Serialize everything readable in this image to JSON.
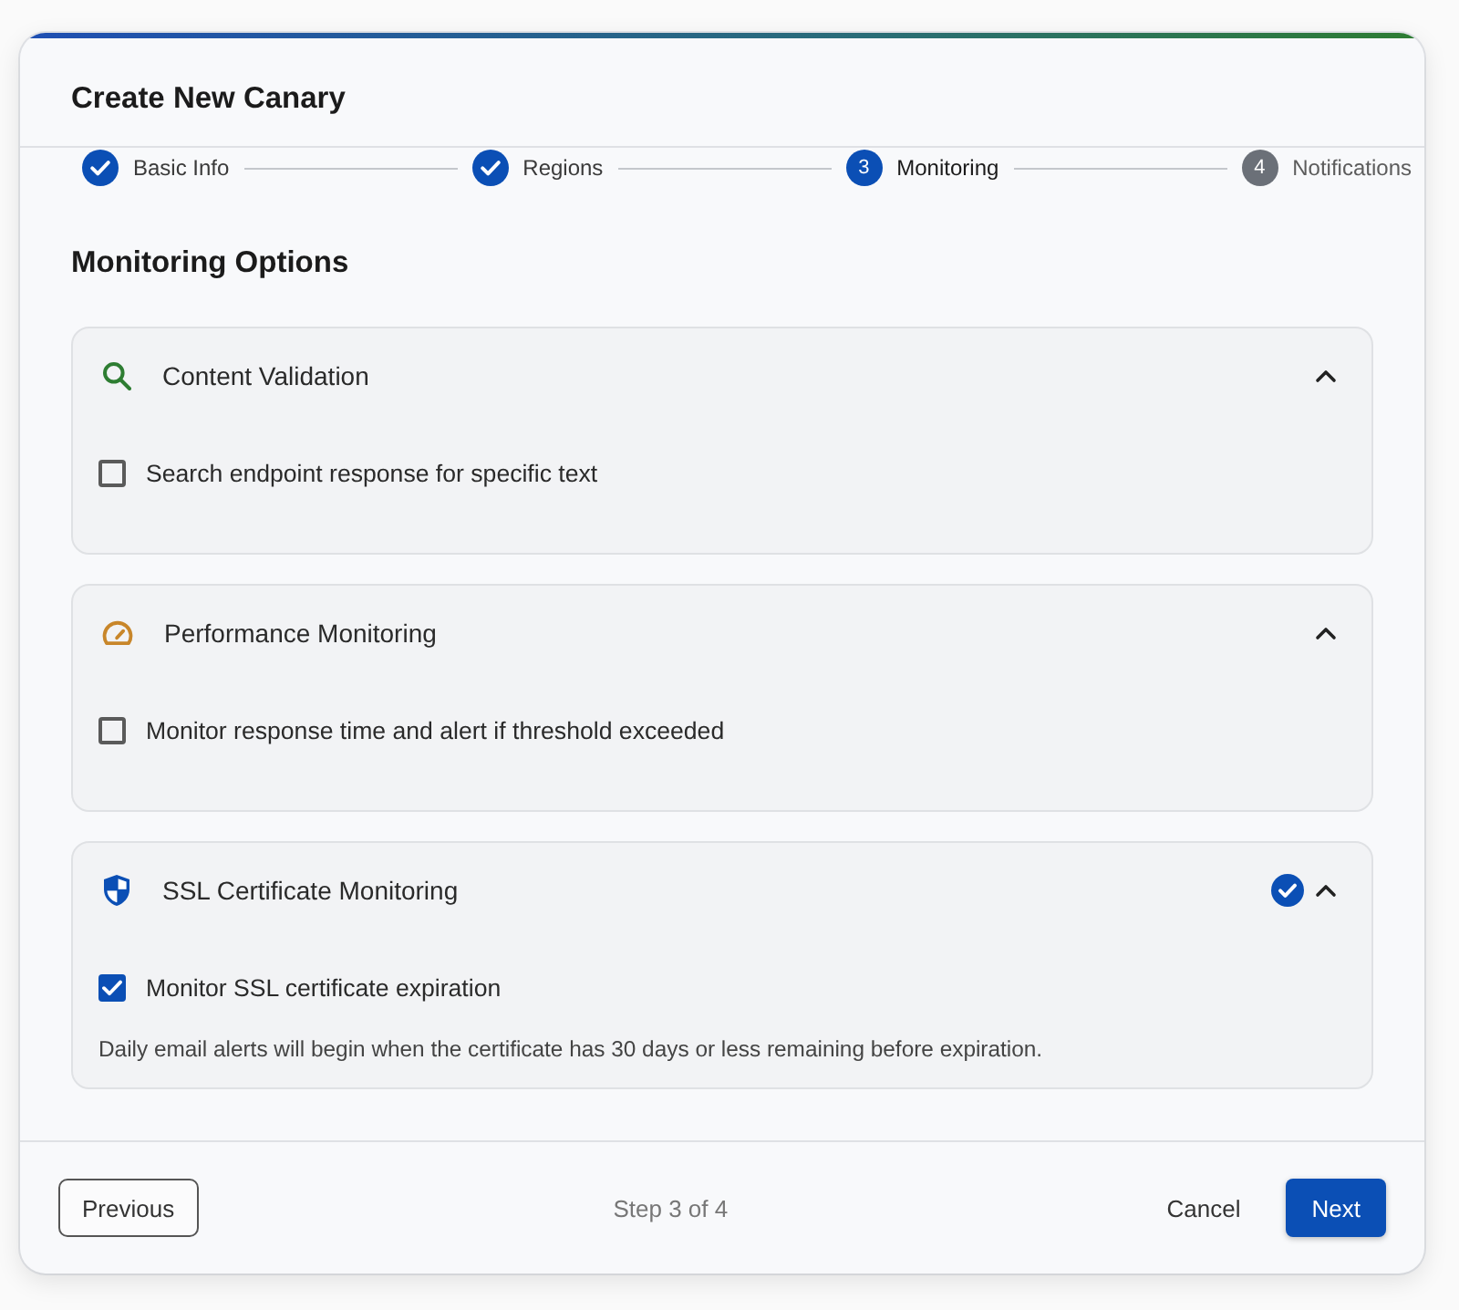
{
  "dialog": {
    "title": "Create New Canary"
  },
  "steps": [
    {
      "label": "Basic Info",
      "completed": true,
      "selected": false
    },
    {
      "label": "Regions",
      "completed": true,
      "selected": false
    },
    {
      "label": "Monitoring",
      "completed": false,
      "selected": true,
      "number": "3"
    },
    {
      "label": "Notifications",
      "completed": false,
      "selected": false,
      "number": "4"
    }
  ],
  "section_title": "Monitoring Options",
  "options": [
    {
      "kind": "validation",
      "title": "Content Validation",
      "expanded": true,
      "verified": false,
      "checkbox": {
        "label": "Search endpoint response for specific text",
        "checked": false
      }
    },
    {
      "kind": "performance",
      "title": "Performance Monitoring",
      "expanded": true,
      "verified": false,
      "checkbox": {
        "label": "Monitor response time and alert if threshold exceeded",
        "checked": false
      }
    },
    {
      "kind": "certificate",
      "title": "SSL Certificate Monitoring",
      "expanded": true,
      "verified": true,
      "checkbox": {
        "label": "Monitor SSL certificate expiration",
        "checked": true
      },
      "note": "Daily email alerts will begin when the certificate has 30 days or less remaining before expiration."
    }
  ],
  "footer": {
    "previous": "Previous",
    "progress": "Step 3 of 4",
    "cancel": "Cancel",
    "next": "Next"
  }
}
